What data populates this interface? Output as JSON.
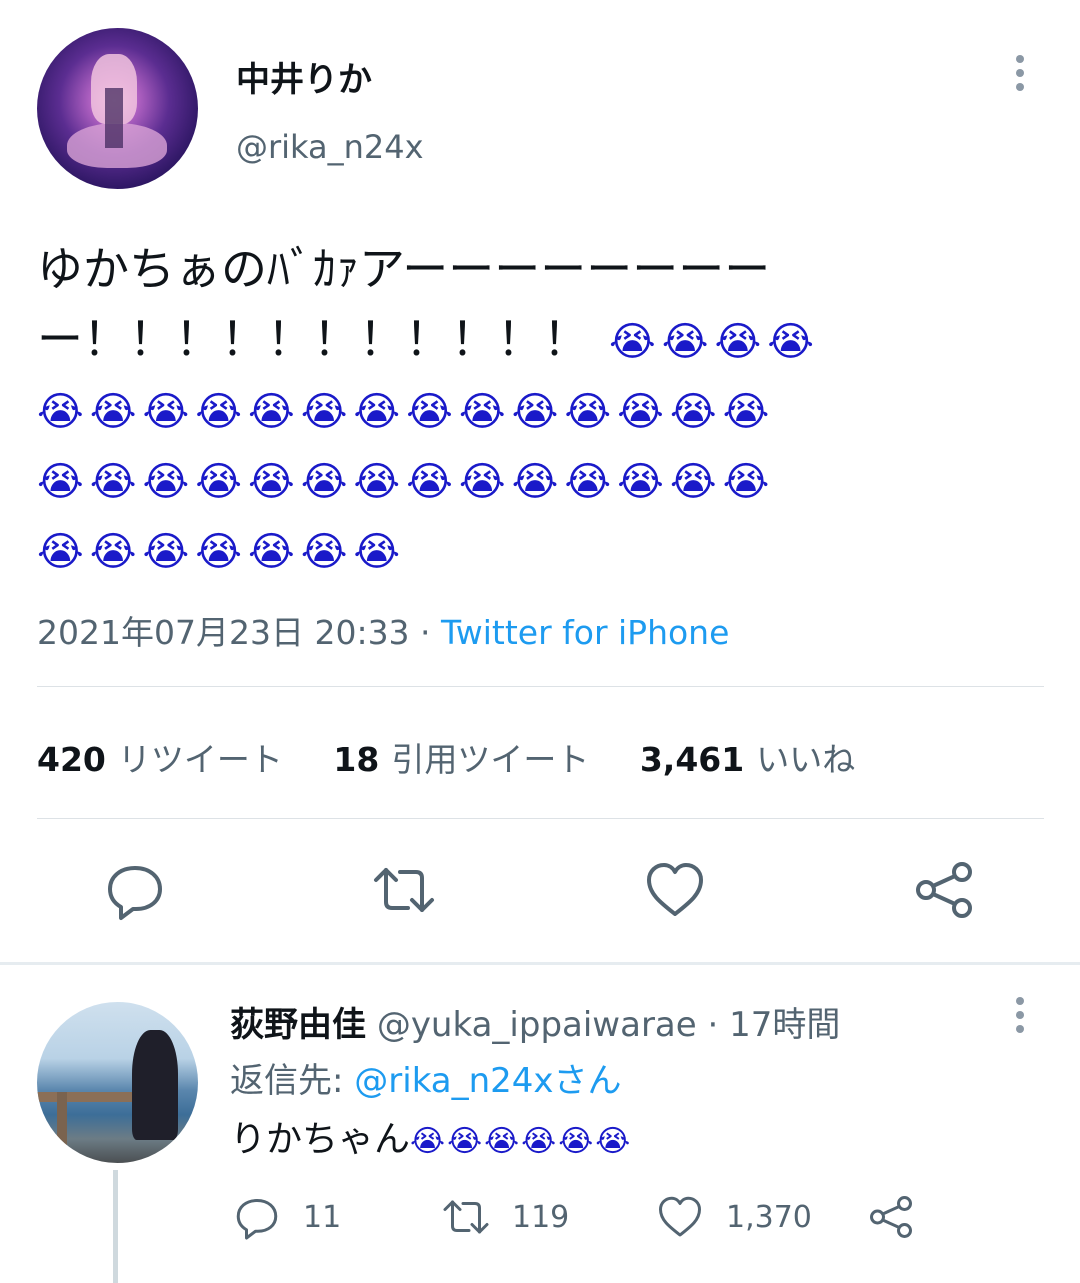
{
  "main_tweet": {
    "author_name": "中井りか",
    "author_handle": "@rika_n24x",
    "text_line1": "ゆかちぁのﾊﾞｶｧアーーーーーーーー",
    "text_line2": "ー！！！！！！！！！！！",
    "emoji_row1": "😭😭😭😭",
    "emoji_row2": "😭😭😭😭😭😭😭😭😭😭😭😭😭😭",
    "emoji_row3": "😭😭😭😭😭😭😭😭😭😭😭😭😭😭",
    "emoji_row4": "😭😭😭😭😭😭😭",
    "timestamp": "2021年07月23日 20:33",
    "separator": " · ",
    "source": "Twitter for iPhone",
    "retweet_count": "420",
    "retweet_label": "リツイート",
    "quote_count": "18",
    "quote_label": "引用ツイート",
    "like_count": "3,461",
    "like_label": "いいね"
  },
  "icons": {
    "more": "more-vertical-icon",
    "reply": "reply-icon",
    "retweet": "retweet-icon",
    "like": "heart-icon",
    "share": "share-icon"
  },
  "reply_tweet": {
    "author_name": "荻野由佳",
    "author_handle": "@yuka_ippaiwarae",
    "time_separator": " · ",
    "time": "17時間",
    "reply_to_label": "返信先: ",
    "reply_to_handle": "@rika_n24xさん",
    "text": "りかちゃん",
    "emojis": "😭😭😭😭😭😭",
    "reply_count": "11",
    "retweet_count": "119",
    "like_count": "1,370"
  },
  "colors": {
    "link": "#1d9bf0",
    "secondary_text": "#536471",
    "emoji_blue": "#1a1ac9"
  }
}
